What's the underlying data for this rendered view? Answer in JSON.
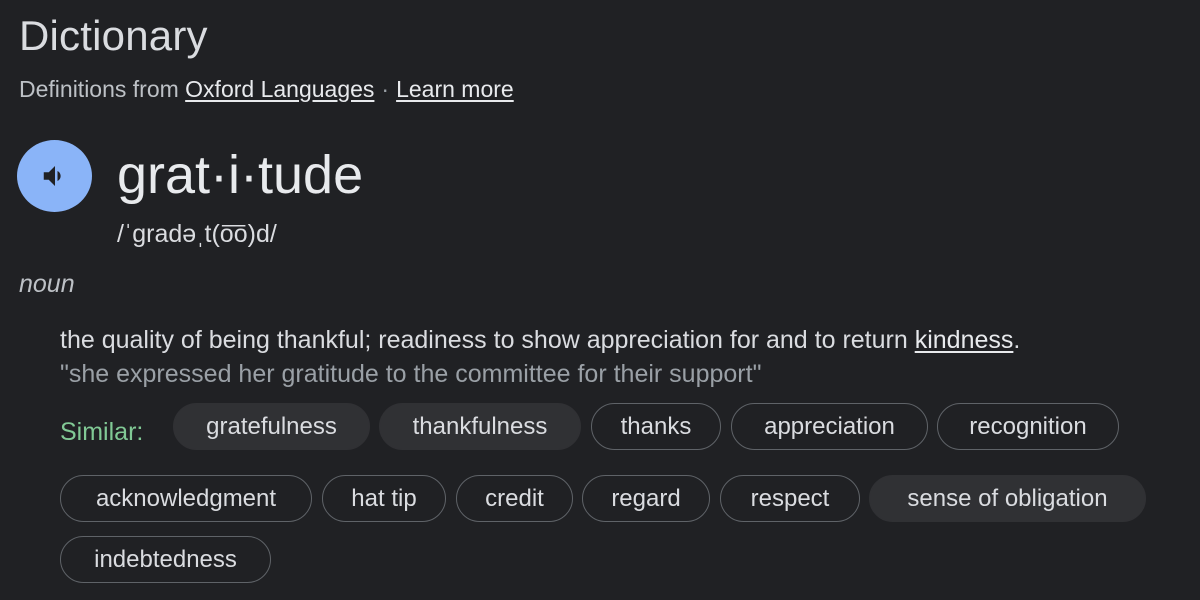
{
  "header": {
    "title": "Dictionary",
    "source_prefix": "Definitions from",
    "source_link": "Oxford Languages",
    "separator": "·",
    "learn_more": "Learn more"
  },
  "entry": {
    "speaker_icon": "volume-icon",
    "word": "grat·i·tude",
    "pronunciation": "/ˈɡradəˌt(o͞o)d/",
    "part_of_speech": "noun",
    "definition_text": "the quality of being thankful; readiness to show appreciation for and to return ",
    "definition_link": "kindness",
    "definition_end": ".",
    "example": "\"she expressed her gratitude to the committee for their support\""
  },
  "similar": {
    "label": "Similar:",
    "chips": [
      {
        "label": "gratefulness",
        "filled": true
      },
      {
        "label": "thankfulness",
        "filled": true
      },
      {
        "label": "thanks",
        "filled": false
      },
      {
        "label": "appreciation",
        "filled": false
      },
      {
        "label": "recognition",
        "filled": false
      },
      {
        "label": "acknowledgment",
        "filled": false
      },
      {
        "label": "hat tip",
        "filled": false
      },
      {
        "label": "credit",
        "filled": false
      },
      {
        "label": "regard",
        "filled": false
      },
      {
        "label": "respect",
        "filled": false
      },
      {
        "label": "sense of obligation",
        "filled": true
      },
      {
        "label": "indebtedness",
        "filled": false
      }
    ]
  },
  "colors": {
    "background": "#202124",
    "speaker_button": "#8ab4f8",
    "similar_label": "#81c995",
    "chip_fill": "#303134",
    "chip_border": "#5f6368"
  }
}
